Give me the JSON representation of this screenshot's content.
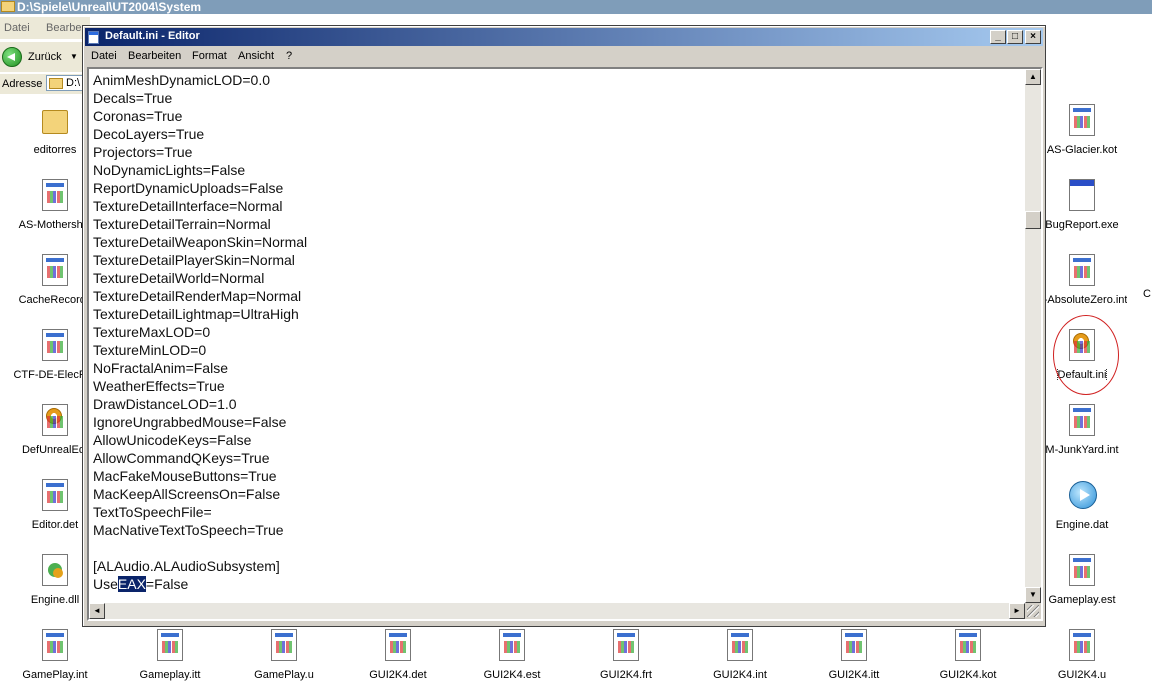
{
  "explorer": {
    "title": "D:\\Spiele\\Unreal\\UT2004\\System",
    "menu": [
      "Datei",
      "Bearbe"
    ],
    "back_label": "Zurück",
    "address_label": "Adresse",
    "address_value": "D:\\"
  },
  "files": [
    {
      "label": "editorres",
      "icon": "folder-icon"
    },
    {
      "label": "AS-Mothership",
      "icon": "config-file-icon"
    },
    {
      "label": "CacheRecords",
      "icon": "config-file-icon"
    },
    {
      "label": "CTF-DE-ElecFiel",
      "icon": "config-file-icon"
    },
    {
      "label": "DefUnrealEd.",
      "icon": "settings-file-icon"
    },
    {
      "label": "Editor.det",
      "icon": "config-file-icon"
    },
    {
      "label": "Engine.dll",
      "icon": "dll-file-icon"
    },
    {
      "label": "GamePlay.int",
      "icon": "config-file-icon"
    },
    {
      "label": "Gameplay.itt",
      "icon": "config-file-icon"
    },
    {
      "label": "GamePlay.u",
      "icon": "config-file-icon"
    },
    {
      "label": "GUI2K4.det",
      "icon": "config-file-icon"
    },
    {
      "label": "GUI2K4.est",
      "icon": "config-file-icon"
    },
    {
      "label": "GUI2K4.frt",
      "icon": "config-file-icon"
    },
    {
      "label": "GUI2K4.int",
      "icon": "config-file-icon"
    },
    {
      "label": "GUI2K4.itt",
      "icon": "config-file-icon"
    },
    {
      "label": "GUI2K4.kot",
      "icon": "config-file-icon"
    },
    {
      "label": "GUI2K4.u",
      "icon": "config-file-icon"
    },
    {
      "label": "AS-Glacier.kot",
      "icon": "config-file-icon"
    },
    {
      "label": "BugReport.exe",
      "icon": "application-icon"
    },
    {
      "label": "F-AbsoluteZero.int",
      "icon": "config-file-icon"
    },
    {
      "label": "Default.ini",
      "icon": "settings-file-icon"
    },
    {
      "label": "M-JunkYard.int",
      "icon": "config-file-icon"
    },
    {
      "label": "Engine.dat",
      "icon": "media-play-icon"
    },
    {
      "label": "Gameplay.est",
      "icon": "config-file-icon"
    },
    {
      "label": "C",
      "icon": "none"
    }
  ],
  "notepad": {
    "title": "Default.ini - Editor",
    "menu": [
      "Datei",
      "Bearbeiten",
      "Format",
      "Ansicht",
      "?"
    ],
    "lines": [
      "AnimMeshDynamicLOD=0.0",
      "Decals=True",
      "Coronas=True",
      "DecoLayers=True",
      "Projectors=True",
      "NoDynamicLights=False",
      "ReportDynamicUploads=False",
      "TextureDetailInterface=Normal",
      "TextureDetailTerrain=Normal",
      "TextureDetailWeaponSkin=Normal",
      "TextureDetailPlayerSkin=Normal",
      "TextureDetailWorld=Normal",
      "TextureDetailRenderMap=Normal",
      "TextureDetailLightmap=UltraHigh",
      "TextureMaxLOD=0",
      "TextureMinLOD=0",
      "NoFractalAnim=False",
      "WeatherEffects=True",
      "DrawDistanceLOD=1.0",
      "IgnoreUngrabbedMouse=False",
      "AllowUnicodeKeys=False",
      "AllowCommandQKeys=True",
      "MacFakeMouseButtons=True",
      "MacKeepAllScreensOn=False",
      "TextToSpeechFile=",
      "MacNativeTextToSpeech=True",
      "",
      "[ALAudio.ALAudioSubsystem]"
    ],
    "last_line": {
      "before": "Use",
      "selected": "EAX",
      "after": "=False"
    },
    "vertical_scroll_fraction": 0.26
  },
  "colors": {
    "title_active": "#0a246a",
    "selection": "#0a246a",
    "annotation": "#d02020"
  }
}
